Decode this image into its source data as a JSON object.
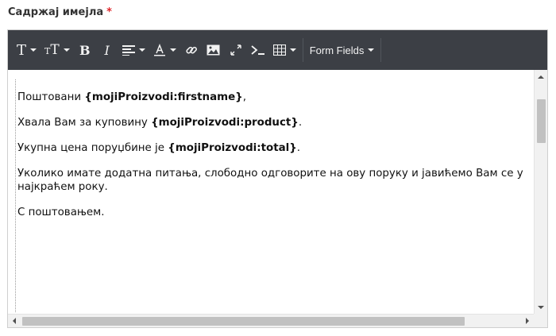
{
  "field": {
    "label": "Садржај имејла",
    "required_marker": "*"
  },
  "toolbar": {
    "font_family_btn": "T",
    "font_size_btn": "TT",
    "bold_btn": "B",
    "italic_btn": "I",
    "form_fields_label": "Form Fields",
    "icons": [
      "font-family-icon",
      "font-size-icon",
      "bold-icon",
      "italic-icon",
      "align-icon",
      "text-color-icon",
      "link-icon",
      "image-icon",
      "fullscreen-icon",
      "code-view-icon",
      "table-icon"
    ]
  },
  "content": {
    "line1_pre": "Поштовани ",
    "line1_tag": "{mojiProizvodi:firstname}",
    "line1_post": ",",
    "line2_pre": "Хвала Вам за куповину ",
    "line2_tag": "{mojiProizvodi:product}",
    "line2_post": ".",
    "line3_pre": "Укупна цена поруџбине је ",
    "line3_tag": "{mojiProizvodi:total}",
    "line3_post": ".",
    "line4": "Уколико имате додатна питања, слободно одговорите на ову поруку и јавићемо Вам се у најкраћем року.",
    "line5": "С поштовањем."
  },
  "colors": {
    "toolbar_bg": "#3c3f45",
    "required": "#e0272b"
  }
}
